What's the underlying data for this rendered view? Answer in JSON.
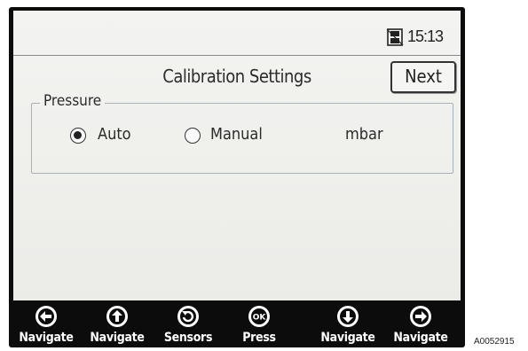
{
  "status_bar": {
    "time": "15:13",
    "status_icon": "memory-card-icon"
  },
  "header": {
    "title": "Calibration Settings",
    "next_label": "Next"
  },
  "pressure": {
    "legend": "Pressure",
    "options": [
      {
        "label": "Auto",
        "selected": true
      },
      {
        "label": "Manual",
        "selected": false
      }
    ],
    "unit": "mbar"
  },
  "softkeys": [
    {
      "label": "Navigate",
      "icon": "arrow-left-icon"
    },
    {
      "label": "Navigate",
      "icon": "arrow-up-icon"
    },
    {
      "label": "Sensors",
      "icon": "rotate-icon"
    },
    {
      "label": "Press",
      "icon": "ok-icon",
      "icon_text": "OK"
    },
    {
      "label": "Navigate",
      "icon": "arrow-down-icon"
    },
    {
      "label": "Navigate",
      "icon": "arrow-right-icon"
    }
  ],
  "figure_id": "A0052915",
  "colors": {
    "screen_background": "#f0f0ee",
    "device_bezel": "#0c0c0c",
    "softkey_text": "#ffffff"
  }
}
